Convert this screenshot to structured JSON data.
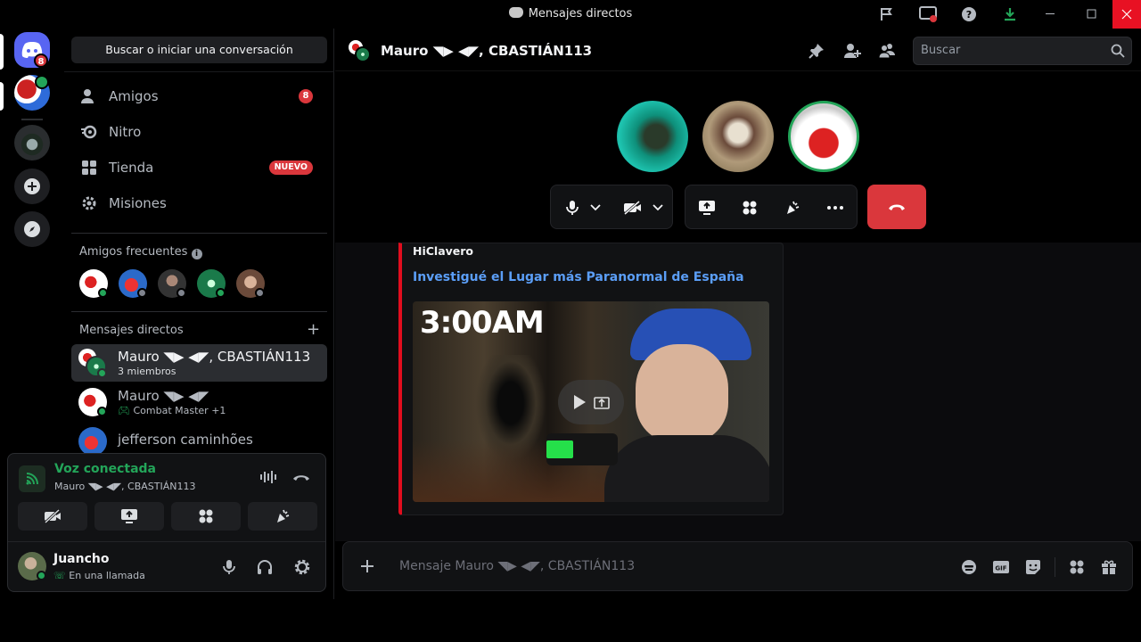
{
  "window": {
    "title": "Mensajes directos"
  },
  "guilds": {
    "home_badge": "8"
  },
  "sidebar": {
    "search_label": "Buscar o iniciar una conversación",
    "nav": [
      {
        "label": "Amigos",
        "badge": "8"
      },
      {
        "label": "Nitro"
      },
      {
        "label": "Tienda",
        "badge": "NUEVO"
      },
      {
        "label": "Misiones"
      }
    ],
    "frequent_header": "Amigos frecuentes",
    "dm_header": "Mensajes directos",
    "dms": [
      {
        "name": "Mauro ◥▶ ◀◤, CBASTIÁN113",
        "sub": "3 miembros"
      },
      {
        "name": "Mauro ◥▶ ◀◤",
        "sub": "Combat Master +1"
      },
      {
        "name": "jefferson caminhões",
        "sub": ""
      }
    ]
  },
  "voice": {
    "status": "Voz conectada",
    "channel": "Mauro ◥▶ ◀◤, CBASTIÁN113"
  },
  "user": {
    "name": "Juancho",
    "status": "En una llamada"
  },
  "header": {
    "title": "Mauro ◥▶ ◀◤, CBASTIÁN113",
    "search_placeholder": "Buscar"
  },
  "embed": {
    "provider": "HiClavero",
    "title": "Investigué el Lugar más Paranormal de España",
    "thumb_text": "3:00AM"
  },
  "composer": {
    "placeholder": "Mensaje Mauro ◥▶ ◀◤, CBASTIÁN113"
  },
  "colors": {
    "accent": "#5865f2",
    "danger": "#da373c",
    "online": "#23a559",
    "link": "#5b9ef7"
  }
}
